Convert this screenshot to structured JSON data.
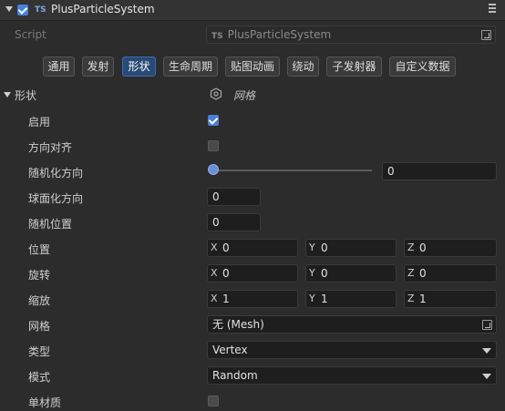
{
  "header": {
    "title": "PlusParticleSystem",
    "ts_badge": "TS",
    "enabled": true
  },
  "script": {
    "label": "Script",
    "value": "PlusParticleSystem",
    "ts_badge": "TS"
  },
  "tabs": [
    {
      "label": "通用",
      "active": false
    },
    {
      "label": "发射",
      "active": false
    },
    {
      "label": "形状",
      "active": true
    },
    {
      "label": "生命周期",
      "active": false
    },
    {
      "label": "贴图动画",
      "active": false
    },
    {
      "label": "绕动",
      "active": false
    },
    {
      "label": "子发射器",
      "active": false
    },
    {
      "label": "自定义数据",
      "active": false
    }
  ],
  "section": {
    "label": "形状",
    "shape_type": "网格"
  },
  "props": {
    "enable": {
      "label": "启用",
      "checked": true
    },
    "align_dir": {
      "label": "方向对齐",
      "checked": false
    },
    "random_dir": {
      "label": "随机化方向",
      "slider_value": 0,
      "value": "0"
    },
    "sphere_dir": {
      "label": "球面化方向",
      "value": "0"
    },
    "random_pos": {
      "label": "随机位置",
      "value": "0"
    },
    "position": {
      "label": "位置",
      "x": "0",
      "y": "0",
      "z": "0"
    },
    "rotation": {
      "label": "旋转",
      "x": "0",
      "y": "0",
      "z": "0"
    },
    "scale": {
      "label": "缩放",
      "x": "1",
      "y": "1",
      "z": "1"
    },
    "mesh": {
      "label": "网格",
      "value": "无 (Mesh)"
    },
    "type": {
      "label": "类型",
      "value": "Vertex"
    },
    "mode": {
      "label": "模式",
      "value": "Random"
    },
    "single_material": {
      "label": "单材质",
      "checked": false
    }
  },
  "axes": {
    "x": "X",
    "y": "Y",
    "z": "Z"
  },
  "colors": {
    "accent": "#4a7fd6",
    "active_tab": "#294a76",
    "background": "#2c2c2c"
  }
}
